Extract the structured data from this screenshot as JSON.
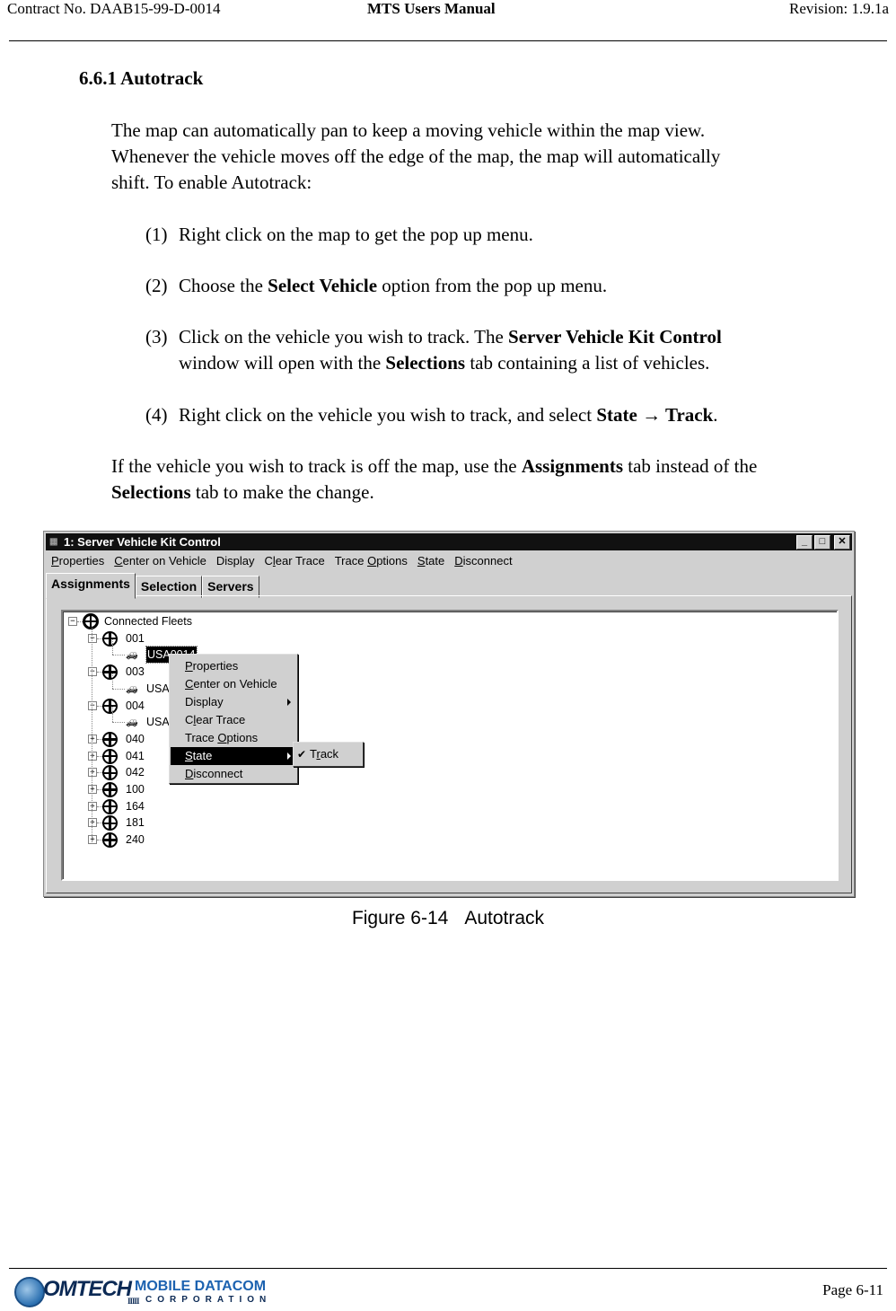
{
  "header": {
    "contract": "Contract No. DAAB15-99-D-0014",
    "title": "MTS Users Manual",
    "revision": "Revision:  1.9.1a"
  },
  "section": {
    "number_title": "6.6.1  Autotrack",
    "intro": [
      "The map can automatically pan to keep a moving vehicle within the map view.",
      "Whenever the vehicle moves off the edge of the map, the map will automatically",
      "shift. To enable Autotrack:"
    ],
    "steps": [
      {
        "num": "(1)",
        "pre": "Right click on the map to get the pop up menu.",
        "bold1": "",
        "mid": "",
        "bold2": "",
        "post": ""
      },
      {
        "num": "(2)",
        "pre": "Choose the ",
        "bold1": "Select Vehicle",
        "mid": " option from the pop up menu.",
        "bold2": "",
        "post": ""
      },
      {
        "num": "(3)",
        "pre": "Click on the vehicle you wish to track. The ",
        "bold1": "Server Vehicle Kit Control",
        "cont_pre": "window will open with the ",
        "cont_bold": "Selections",
        "cont_post": " tab containing a list of vehicles."
      },
      {
        "num": "(4)",
        "pre": "Right click on the vehicle you wish to track, and select ",
        "bold1": "State",
        "arrow": " → ",
        "bold2": "Track",
        "post": "."
      }
    ],
    "note": {
      "pre": "If the vehicle you wish to track is off the map, use the ",
      "bold1": "Assignments",
      "mid": " tab instead of the",
      "bold2": "Selections",
      "post": " tab to make the change."
    }
  },
  "window": {
    "title": "1: Server Vehicle Kit Control",
    "controls": {
      "minimize": "_",
      "maximize": "□",
      "close": "✕"
    },
    "menu": [
      {
        "u": "P",
        "rest": "roperties"
      },
      {
        "u": "C",
        "rest": "enter on Vehicle"
      },
      {
        "u": "",
        "rest": "Display"
      },
      {
        "pre": "C",
        "u": "l",
        "rest": "ear Trace"
      },
      {
        "pre": "Trace ",
        "u": "O",
        "rest": "ptions"
      },
      {
        "u": "S",
        "rest": "tate"
      },
      {
        "u": "D",
        "rest": "isconnect"
      }
    ],
    "tabs": [
      "Assignments",
      "Selection",
      "Servers"
    ],
    "active_tab": "Assignments",
    "tree": {
      "root": "Connected Fleets",
      "fleets": [
        {
          "id": "001",
          "expanded": true,
          "vehicle": "USA0014",
          "selected": true
        },
        {
          "id": "003",
          "expanded": true,
          "vehicle": "USA"
        },
        {
          "id": "004",
          "expanded": true,
          "vehicle": "USA"
        },
        {
          "id": "040",
          "expanded": false
        },
        {
          "id": "041",
          "expanded": false
        },
        {
          "id": "042",
          "expanded": false
        },
        {
          "id": "100",
          "expanded": false
        },
        {
          "id": "164",
          "expanded": false
        },
        {
          "id": "181",
          "expanded": false
        },
        {
          "id": "240",
          "expanded": false
        }
      ]
    },
    "context_menu": [
      {
        "pre": "",
        "u": "P",
        "rest": "roperties",
        "submenu": false
      },
      {
        "pre": "",
        "u": "C",
        "rest": "enter on Vehicle",
        "submenu": false
      },
      {
        "pre": "",
        "u": "",
        "rest": "Display",
        "submenu": true
      },
      {
        "pre": "C",
        "u": "l",
        "rest": "ear Trace",
        "submenu": false
      },
      {
        "pre": "Trace ",
        "u": "O",
        "rest": "ptions",
        "submenu": false
      },
      {
        "pre": "",
        "u": "S",
        "rest": "tate",
        "submenu": true,
        "highlighted": true
      },
      {
        "pre": "",
        "u": "D",
        "rest": "isconnect",
        "submenu": false
      }
    ],
    "submenu": {
      "check": "✔",
      "pre": "T",
      "u": "r",
      "rest": "ack",
      "checked": true
    }
  },
  "figure": {
    "number": "Figure 6-14",
    "title": "Autotrack"
  },
  "footer": {
    "logo_main": "OMTECH",
    "logo_sub": "MOBILE DATACOM",
    "logo_corp": "CORPORATION",
    "page": "Page 6-11"
  }
}
